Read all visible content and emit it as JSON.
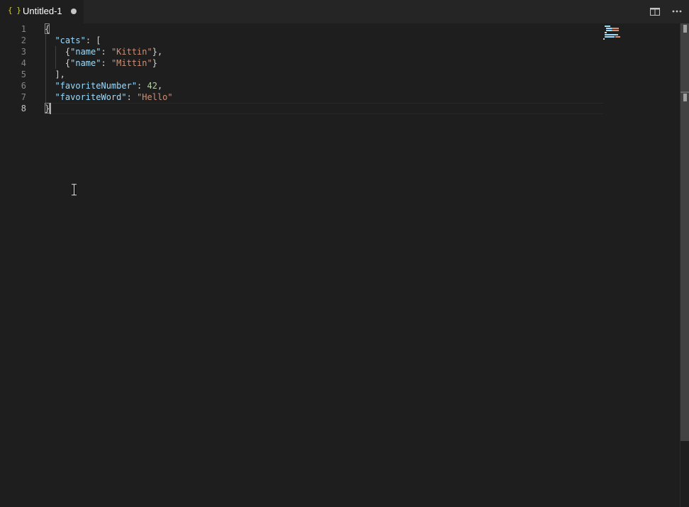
{
  "tab": {
    "icon": "{ }",
    "title": "Untitled-1",
    "dirty": true
  },
  "actions": {
    "split_editor": "split-editor-icon",
    "more": "more-actions-icon"
  },
  "editor": {
    "line_numbers": [
      "1",
      "2",
      "3",
      "4",
      "5",
      "6",
      "7",
      "8"
    ],
    "lines": [
      [
        {
          "t": "{",
          "c": "p"
        }
      ],
      [
        {
          "t": "  ",
          "c": "p"
        },
        {
          "t": "\"cats\"",
          "c": "k"
        },
        {
          "t": ": [",
          "c": "p"
        }
      ],
      [
        {
          "t": "    {",
          "c": "p"
        },
        {
          "t": "\"name\"",
          "c": "k"
        },
        {
          "t": ": ",
          "c": "p"
        },
        {
          "t": "\"Kittin\"",
          "c": "s"
        },
        {
          "t": "},",
          "c": "p"
        }
      ],
      [
        {
          "t": "    {",
          "c": "p"
        },
        {
          "t": "\"name\"",
          "c": "k"
        },
        {
          "t": ": ",
          "c": "p"
        },
        {
          "t": "\"Mittin\"",
          "c": "s"
        },
        {
          "t": "}",
          "c": "p"
        }
      ],
      [
        {
          "t": "  ],",
          "c": "p"
        }
      ],
      [
        {
          "t": "  ",
          "c": "p"
        },
        {
          "t": "\"favoriteNumber\"",
          "c": "k"
        },
        {
          "t": ": ",
          "c": "p"
        },
        {
          "t": "42",
          "c": "n"
        },
        {
          "t": ",",
          "c": "p"
        }
      ],
      [
        {
          "t": "  ",
          "c": "p"
        },
        {
          "t": "\"favoriteWord\"",
          "c": "k"
        },
        {
          "t": ": ",
          "c": "p"
        },
        {
          "t": "\"Hello\"",
          "c": "s"
        }
      ],
      [
        {
          "t": "}",
          "c": "p"
        }
      ]
    ],
    "active_line": 8,
    "colors": {
      "background": "#1e1e1e",
      "key": "#9cdcfe",
      "string": "#ce9178",
      "number": "#b5cea8",
      "punctuation": "#d4d4d4",
      "file_icon": "#cbcb41"
    }
  }
}
